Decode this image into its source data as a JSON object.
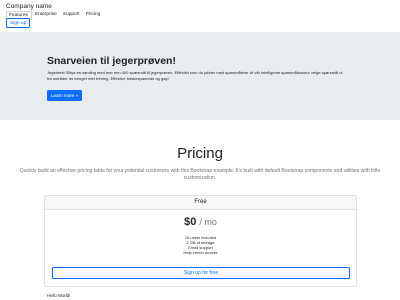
{
  "header": {
    "brand": "Company name",
    "nav": [
      "Features",
      "Enterprise",
      "Support",
      "Pricing"
    ],
    "signup_label": "Sign up"
  },
  "jumbotron": {
    "title": "Snarveien til jegerprøven!",
    "text": "Jegerbest Slitya en samling med mer enn 400 spørsmål til jegerprøven. Effektivt som du jobber med spørsmålene vil vår intelligente spørsmålsmotor velge spørsmål ut fra områder du trenger mer trening. Effektivt, tidsbesparende og gøy!",
    "button_label": "Learn more »"
  },
  "pricing": {
    "title": "Pricing",
    "lead": "Quickly build an effective pricing table for your potential customers with this Bootstrap example. It's built with default Bootstrap components and utilities with little customization.",
    "card": {
      "header": "Free",
      "price": "$0",
      "period": "/ mo",
      "features": [
        "10 users included",
        "2 GB of storage",
        "Email support",
        "Help center access"
      ],
      "button_label": "Sign up for free"
    }
  },
  "footer": {
    "text": "Hello World!"
  },
  "colors": {
    "accent": "#0d6efd",
    "jumbotron_bg": "#e9ecef"
  }
}
